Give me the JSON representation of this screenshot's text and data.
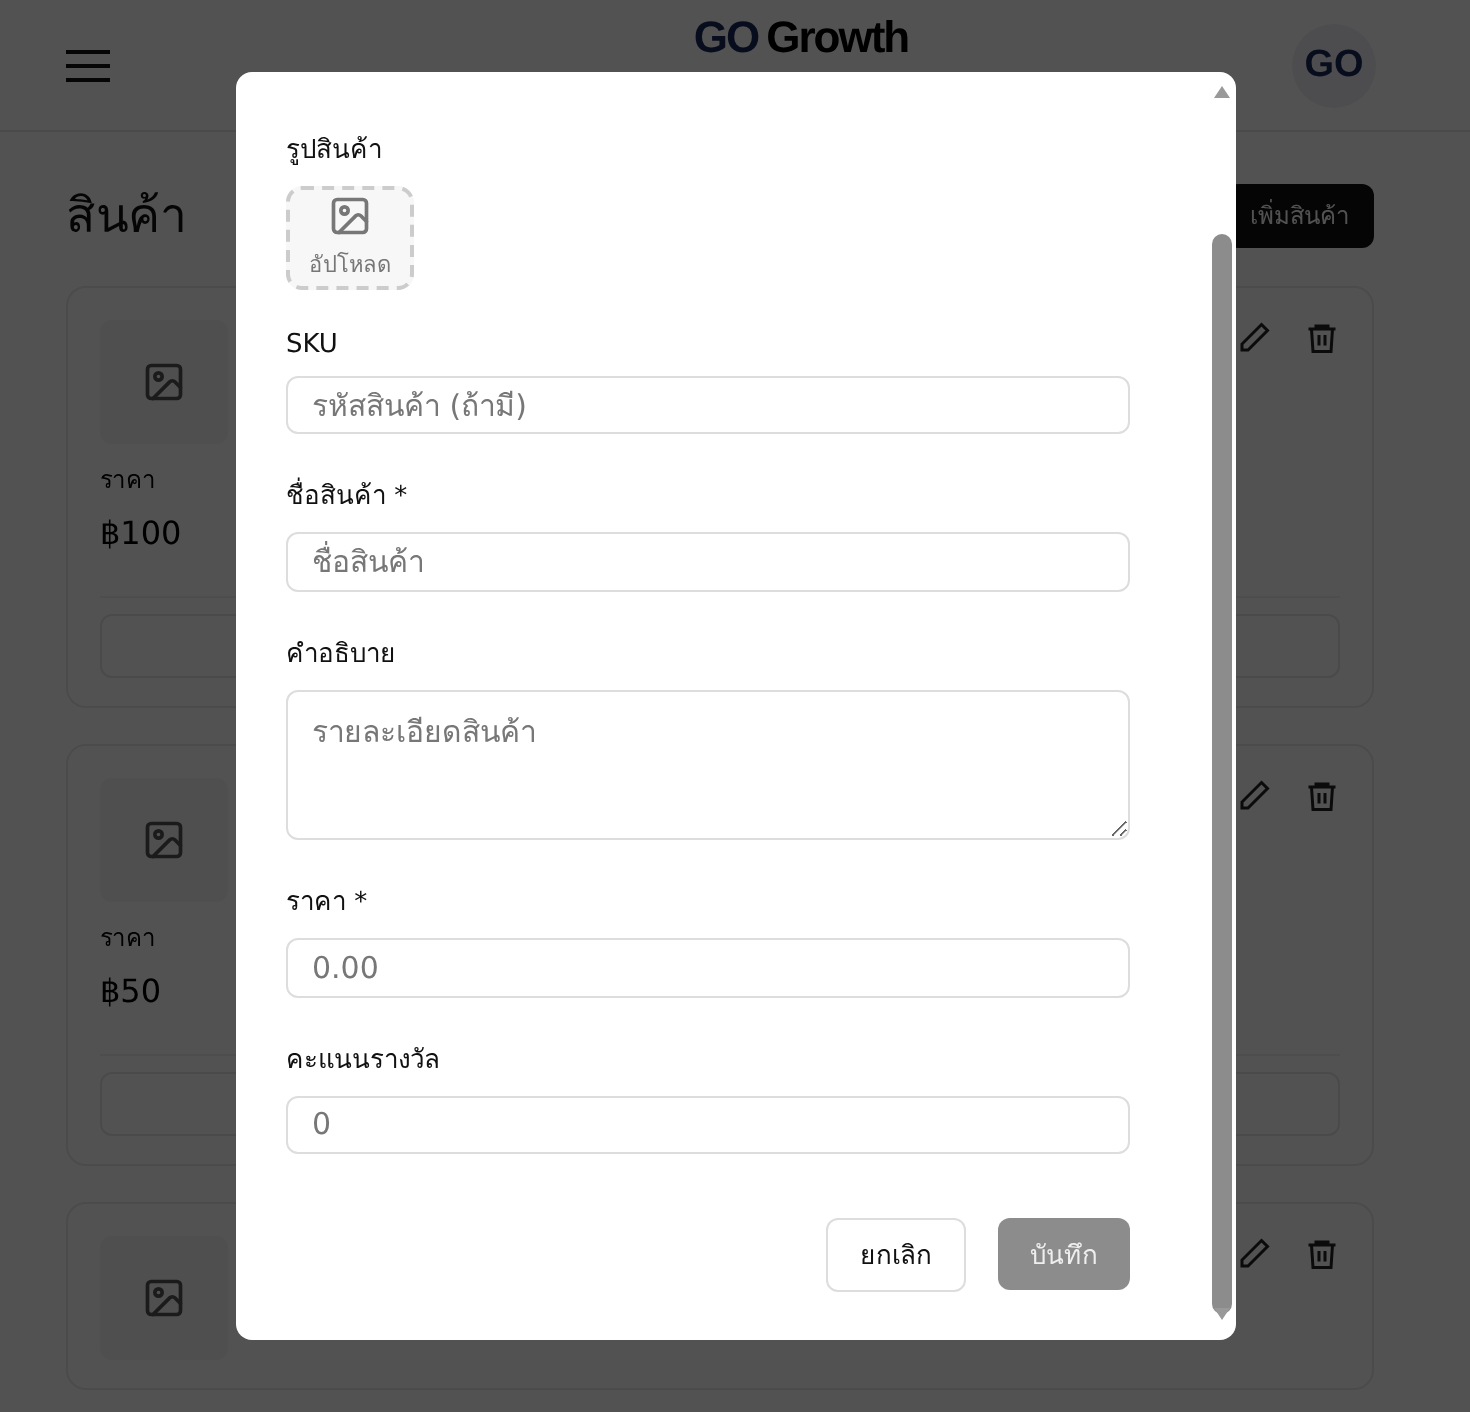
{
  "header": {
    "logo_prefix": "GO",
    "logo_word": "Growth",
    "avatar": "GO"
  },
  "page": {
    "title": "สินค้า",
    "add_button": "เพิ่มสินค้า"
  },
  "products": [
    {
      "kind": "product",
      "price_label": "ราคา",
      "price": "฿100"
    },
    {
      "kind": "product",
      "price_label": "ราคา",
      "price": "฿50"
    },
    {
      "kind": "product"
    }
  ],
  "dialog": {
    "image_label": "รูปสินค้า",
    "upload": "อัปโหลด",
    "fields": [
      {
        "kind": "input",
        "label": "SKU",
        "placeholder": "รหัสสินค้า (ถ้ามี)"
      },
      {
        "kind": "input",
        "label": "ชื่อสินค้า *",
        "placeholder": "ชื่อสินค้า"
      },
      {
        "kind": "textarea",
        "label": "คำอธิบาย",
        "placeholder": "รายละเอียดสินค้า"
      },
      {
        "kind": "input",
        "label": "ราคา *",
        "placeholder": "0.00"
      },
      {
        "kind": "input",
        "label": "คะแนนรางวัล",
        "placeholder": "0"
      }
    ],
    "cancel": "ยกเลิก",
    "save": {
      "label": "บันทึก",
      "disabled": true
    }
  }
}
